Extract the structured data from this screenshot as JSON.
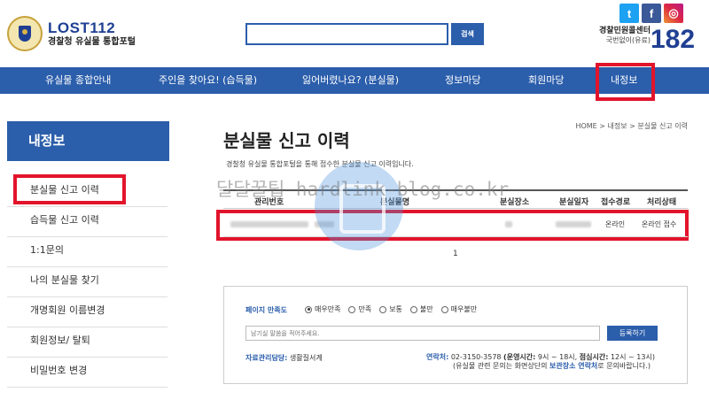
{
  "header": {
    "logo_title": "LOST112",
    "logo_subtitle": "경찰청 유실물 통합포털",
    "search_placeholder": "",
    "search_button": "검색",
    "sns": [
      "t",
      "f",
      "◎"
    ],
    "call_center_label": "경찰민원콜센터",
    "call_center_sub": "국번없이(유료)",
    "call_center_number": "182"
  },
  "nav": {
    "items": [
      {
        "label": "유실물 종합안내"
      },
      {
        "label": "주인을 찾아요! (습득물)"
      },
      {
        "label": "잃어버렸나요? (분실물)"
      },
      {
        "label": "정보마당"
      },
      {
        "label": "회원마당"
      },
      {
        "label": "내정보"
      }
    ]
  },
  "sidebar": {
    "title": "내정보",
    "items": [
      {
        "label": "분실물 신고 이력"
      },
      {
        "label": "습득물 신고 이력"
      },
      {
        "label": "1:1문의"
      },
      {
        "label": "나의 분실물 찾기"
      },
      {
        "label": "개명회원 이름변경"
      },
      {
        "label": "회원정보/ 탈퇴"
      },
      {
        "label": "비밀번호 변경"
      }
    ]
  },
  "main": {
    "title": "분실물 신고 이력",
    "breadcrumb": "HOME > 내정보 > 분실물 신고 이력",
    "description": "경찰청 유실물 통합포털을 통해 접수한 분실물 신고 이력입니다.",
    "watermark": "달달꿀팁 hardlink-blog.co.kr",
    "table": {
      "headers": [
        "관리번호",
        "분실물명",
        "분실장소",
        "분실일자",
        "접수경로",
        "처리상태"
      ],
      "rows": [
        {
          "route": "온라인",
          "status": "온라인 접수"
        }
      ]
    },
    "page": "1"
  },
  "feedback": {
    "label": "페이지 만족도",
    "options": [
      "매우만족",
      "만족",
      "보통",
      "불만",
      "매우불만"
    ],
    "selected": 0,
    "input_placeholder": "남기실 말씀을 적어주세요.",
    "submit": "등록하기",
    "manager_label": "자료관리담당:",
    "manager_value": "생활질서계",
    "contact_label": "연락처:",
    "contact_phone": "02-3150-3578",
    "hours_label": "(운영시간:",
    "hours_value": "9시 ~ 18시,",
    "lunch_label": "점심시간:",
    "lunch_value": "12시 ~ 13시)",
    "note_prefix": "(유실물 관련 문의는 화면상단의",
    "note_link": "보관장소 연락처",
    "note_suffix": "로 문의바랍니다.)"
  },
  "colors": {
    "brand_blue": "#2b5eab",
    "highlight_red": "#e2142b"
  }
}
